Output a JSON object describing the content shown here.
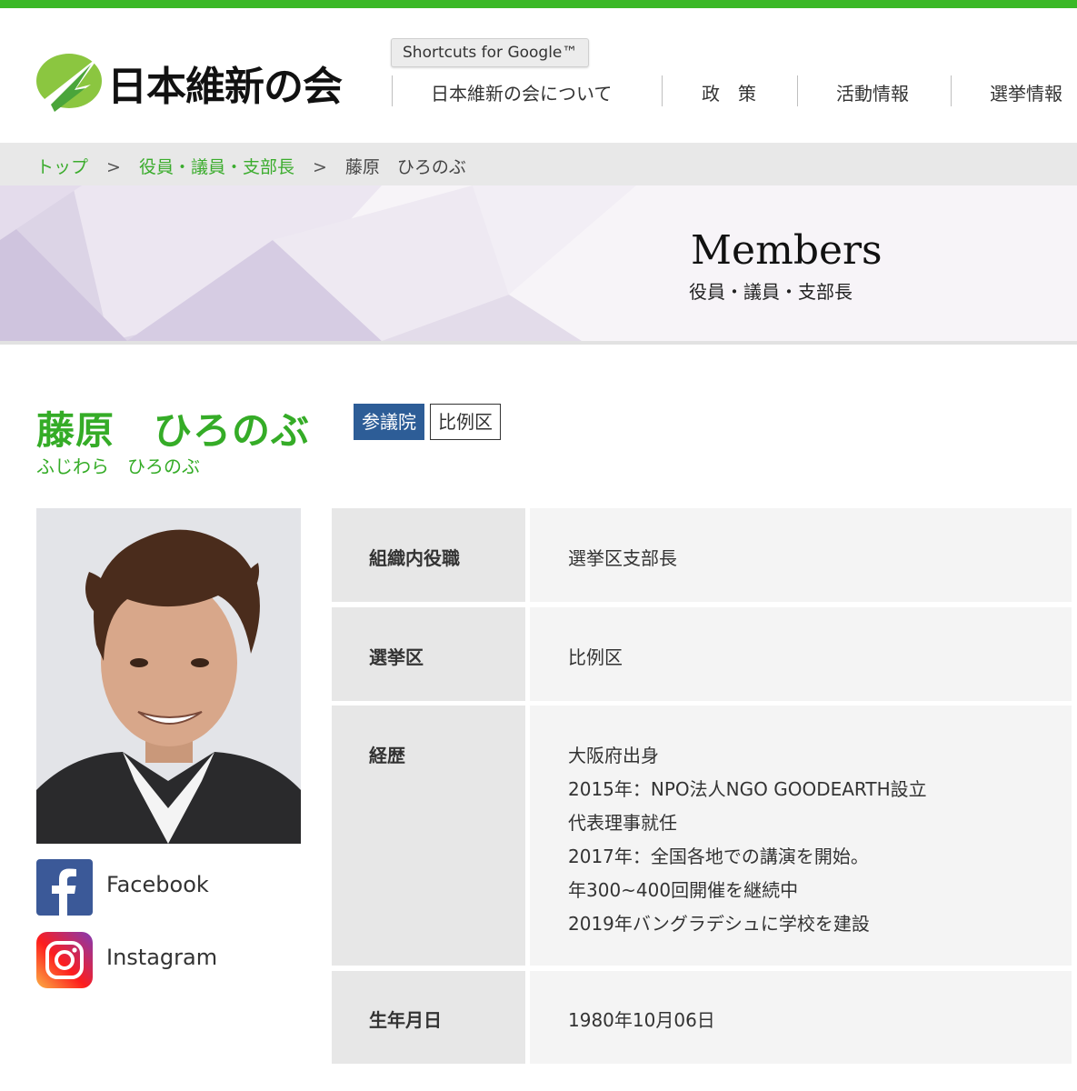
{
  "header": {
    "logo_text": "日本維新の会",
    "tooltip": "Shortcuts for Google™",
    "nav": [
      {
        "label": "日本維新の会について"
      },
      {
        "label": "政　策"
      },
      {
        "label": "活動情報"
      },
      {
        "label": "選挙情報"
      }
    ]
  },
  "breadcrumb": {
    "items": [
      "トップ",
      "役員・議員・支部長",
      "藤原　ひろのぶ"
    ],
    "separator": ">"
  },
  "hero": {
    "title": "Members",
    "subtitle": "役員・議員・支部長"
  },
  "member": {
    "name": "藤原　ひろのぶ",
    "kana": "ふじわら　ひろのぶ",
    "badges": {
      "house": "参議院",
      "district": "比例区"
    }
  },
  "social": [
    {
      "icon": "facebook-icon",
      "label": "Facebook"
    },
    {
      "icon": "instagram-icon",
      "label": "Instagram"
    }
  ],
  "profile": {
    "rows": [
      {
        "label": "組織内役職",
        "lines": [
          "選挙区支部長"
        ]
      },
      {
        "label": "選挙区",
        "lines": [
          "比例区"
        ]
      },
      {
        "label": "経歴",
        "lines": [
          "大阪府出身",
          "2015年：NPO法人NGO GOODEARTH設立",
          "代表理事就任",
          "2017年：全国各地での講演を開始。",
          "年300~400回開催を継続中",
          "2019年バングラデシュに学校を建設"
        ]
      },
      {
        "label": "生年月日",
        "lines": [
          "1980年10月06日"
        ]
      }
    ]
  },
  "colors": {
    "brand_green": "#3bb826",
    "name_green": "#35ac27",
    "house_badge": "#2d5d97",
    "facebook": "#3b5998"
  }
}
